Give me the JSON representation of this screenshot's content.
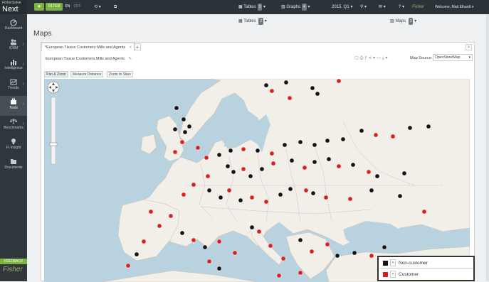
{
  "app": {
    "logo_top": "FisherSolve",
    "logo_main": "Next",
    "logo_mark": "™"
  },
  "topbar": {
    "filter_label": "FILTER",
    "on_label": "ON",
    "off_label": "OFF",
    "tables_label": "Tables",
    "tables_count": "2",
    "graphs_label": "Graphs",
    "graphs_count": "4",
    "maps_label": "Maps",
    "maps_count": "3",
    "period": "2015, Q1",
    "brand": "Fisher",
    "welcome": "Welcome, Matt Elhardt"
  },
  "sidebar": {
    "items": [
      {
        "label": "Dashboard",
        "icon": "dashboard-icon"
      },
      {
        "label": "iCRM",
        "icon": "people-icon"
      },
      {
        "label": "Intelligence",
        "icon": "bar-chart-icon"
      },
      {
        "label": "Trends",
        "icon": "trend-icon"
      },
      {
        "label": "Tools",
        "icon": "toolbox-icon"
      },
      {
        "label": "Benchmarks",
        "icon": "scale-icon"
      },
      {
        "label": "FI Insight",
        "icon": "lightbulb-icon"
      },
      {
        "label": "Documents",
        "icon": "folder-icon"
      }
    ],
    "feedback": "FEEDBACK",
    "footer_logo": "Fisher"
  },
  "page": {
    "title": "Maps"
  },
  "panel": {
    "tab_label": "*European Tissue Customers Mills and Agents",
    "add_tab": "+",
    "subtitle": "European Tissue Customers Mills and Agents",
    "map_source_label": "Map Source:",
    "map_source_value": "OpenStreetMap",
    "buttons": [
      "Pan & Zoom",
      "Measure Distance",
      "Zoom to Sites"
    ]
  },
  "legend": {
    "items": [
      {
        "label": "Non-customer",
        "color": "#111111"
      },
      {
        "label": "Customer",
        "color": "#e01b1b"
      }
    ]
  },
  "colors": {
    "topbar": "#2b3338",
    "sidebar": "#2f373c",
    "accent_green": "#7cb342",
    "marker_black": "#111111",
    "marker_red": "#e01b1b",
    "sea": "#b9d2df",
    "land": "#f2efe9"
  }
}
